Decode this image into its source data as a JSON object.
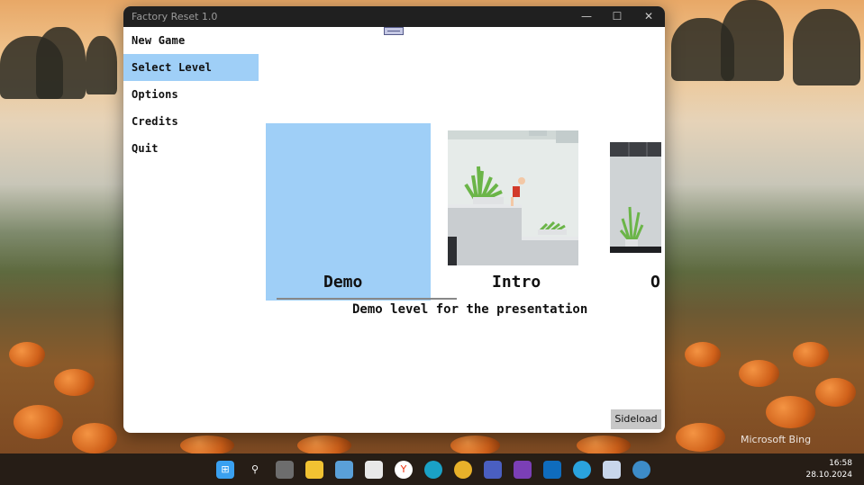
{
  "window": {
    "title": "Factory Reset 1.0",
    "controls": {
      "minimize": "—",
      "maximize": "☐",
      "close": "✕"
    }
  },
  "menu": {
    "items": [
      {
        "label": "New Game"
      },
      {
        "label": "Select Level"
      },
      {
        "label": "Options"
      },
      {
        "label": "Credits"
      },
      {
        "label": "Quit"
      }
    ],
    "selected_index": 1
  },
  "levels": {
    "cards": [
      {
        "label": "Demo"
      },
      {
        "label": "Intro"
      },
      {
        "label": "O"
      }
    ],
    "selected_description": "Demo level for the presentation"
  },
  "sideload_label": "Sideload",
  "taskbar": {
    "time": "16:58",
    "date": "28.10.2024"
  },
  "wallpaper_watermark": "Microsoft Bing",
  "colors": {
    "accent": "#9fcff7",
    "titlebar": "#202020"
  }
}
